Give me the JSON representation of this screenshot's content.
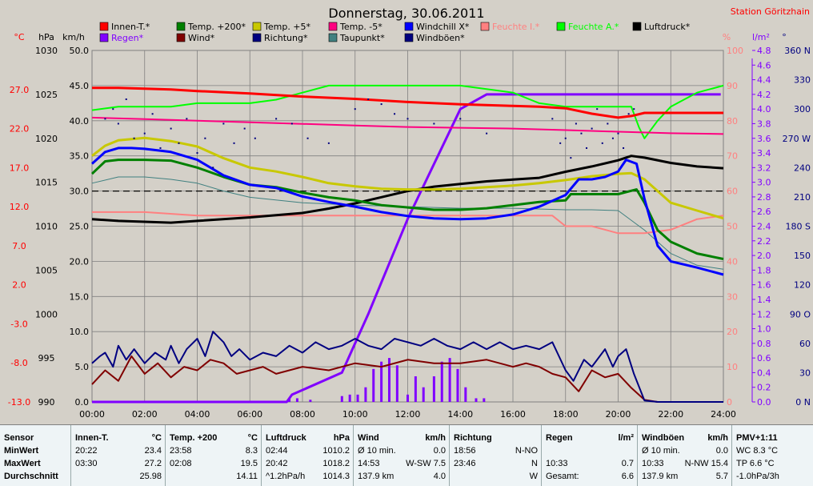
{
  "chart_data": {
    "type": "line",
    "title": "Donnerstag, 30.06.2011",
    "station": "Station Göritzhain",
    "x_range": [
      "00:00",
      "24:00"
    ],
    "x_ticks": [
      "00:00",
      "02:00",
      "04:00",
      "06:00",
      "08:00",
      "10:00",
      "12:00",
      "14:00",
      "16:00",
      "18:00",
      "20:00",
      "22:00",
      "24:00"
    ],
    "axes": {
      "celsius": {
        "unit": "°C",
        "range": [
          -13.0,
          32.0
        ],
        "ticks": [
          "27.0",
          "22.0",
          "17.0",
          "12.0",
          "7.0",
          "2.0",
          "-3.0",
          "-8.0",
          "-13.0"
        ]
      },
      "hpa": {
        "unit": "hPa",
        "range": [
          990,
          1030
        ],
        "ticks": [
          "1030",
          "1025",
          "1020",
          "1015",
          "1010",
          "1005",
          "1000",
          "995",
          "990"
        ]
      },
      "kmh": {
        "unit": "km/h",
        "range": [
          0.0,
          50.0
        ],
        "ticks": [
          "50.0",
          "45.0",
          "40.0",
          "35.0",
          "30.0",
          "25.0",
          "20.0",
          "15.0",
          "10.0",
          "5.0",
          "0.0"
        ]
      },
      "percent": {
        "unit": "%",
        "range": [
          0,
          100
        ],
        "ticks": [
          "100",
          "90",
          "80",
          "70",
          "60",
          "50",
          "40",
          "30",
          "20",
          "10",
          "0"
        ]
      },
      "rain": {
        "unit": "l/m²",
        "range": [
          0.0,
          4.8
        ],
        "ticks": [
          "4.8",
          "4.6",
          "4.4",
          "4.2",
          "4.0",
          "3.8",
          "3.6",
          "3.4",
          "3.2",
          "3.0",
          "2.8",
          "2.6",
          "2.4",
          "2.2",
          "2.0",
          "1.8",
          "1.6",
          "1.4",
          "1.2",
          "1.0",
          "0.8",
          "0.6",
          "0.4",
          "0.2",
          "0.0"
        ]
      },
      "direction": {
        "unit": "°",
        "range": [
          0,
          360
        ],
        "ticks": [
          "360 N",
          "330",
          "300",
          "270 W",
          "240",
          "210",
          "180 S",
          "150",
          "120",
          "90 O",
          "60",
          "30",
          "0 N"
        ]
      }
    },
    "legend": [
      {
        "name": "Innen-T.*",
        "color": "#ff0000"
      },
      {
        "name": "Temp. +200*",
        "color": "#008000"
      },
      {
        "name": "Temp. +5*",
        "color": "#c8c800"
      },
      {
        "name": "Temp. -5*",
        "color": "#ff0080"
      },
      {
        "name": "Windchill X*",
        "color": "#0000ff"
      },
      {
        "name": "Feuchte I.*",
        "color": "#ff8080"
      },
      {
        "name": "Feuchte A.*",
        "color": "#00ff00"
      },
      {
        "name": "Luftdruck*",
        "color": "#000000"
      },
      {
        "name": "Regen*",
        "color": "#8000ff"
      },
      {
        "name": "Wind*",
        "color": "#800000"
      },
      {
        "name": "Richtung*",
        "color": "#000080"
      },
      {
        "name": "Taupunkt*",
        "color": "#408080"
      },
      {
        "name": "Windböen*",
        "color": "#000080"
      }
    ],
    "series": [
      {
        "name": "Innen-T.*",
        "axis": "celsius",
        "color": "#ff0000",
        "width": 3,
        "x": [
          0,
          1,
          2,
          3,
          4,
          6,
          8,
          10,
          12,
          14,
          16,
          17,
          18,
          19,
          20,
          20.5,
          21,
          22,
          24
        ],
        "y": [
          27.2,
          27.2,
          27.1,
          27.0,
          26.8,
          26.5,
          26.1,
          25.8,
          25.4,
          25.1,
          24.9,
          24.8,
          24.6,
          23.9,
          23.4,
          23.6,
          24.0,
          24.0,
          24.0
        ]
      },
      {
        "name": "Temp. +200*",
        "axis": "celsius",
        "color": "#008000",
        "width": 3,
        "x": [
          0,
          0.5,
          1,
          2,
          3,
          4,
          5,
          6,
          7,
          8,
          9,
          10,
          11,
          12,
          13,
          14,
          15,
          16,
          17,
          18,
          18.2,
          19,
          20,
          20.7,
          21,
          21.5,
          22,
          23,
          24
        ],
        "y": [
          16.2,
          17.8,
          18.0,
          18.0,
          17.9,
          17.0,
          15.8,
          14.8,
          14.5,
          13.8,
          13.2,
          12.8,
          12.2,
          11.9,
          11.6,
          11.6,
          11.8,
          12.2,
          12.6,
          12.8,
          13.6,
          13.6,
          13.6,
          14.2,
          12.5,
          9.0,
          7.5,
          6.0,
          5.3
        ]
      },
      {
        "name": "Temp. +5*",
        "axis": "celsius",
        "color": "#c8c800",
        "width": 3,
        "x": [
          0,
          0.5,
          1,
          2,
          3,
          4,
          5,
          6,
          7,
          8,
          9,
          10,
          11,
          12,
          13,
          14,
          15,
          16,
          17,
          18,
          19,
          20,
          20.5,
          21,
          21.5,
          22,
          23,
          24
        ],
        "y": [
          18.5,
          19.8,
          20.5,
          20.8,
          20.4,
          19.7,
          18.2,
          17.0,
          16.5,
          15.8,
          15.0,
          14.6,
          14.3,
          14.2,
          14.2,
          14.3,
          14.5,
          14.7,
          15.0,
          15.4,
          15.9,
          16.2,
          16.3,
          15.5,
          14.0,
          12.5,
          11.5,
          10.5
        ]
      },
      {
        "name": "Temp. -5*",
        "axis": "celsius",
        "color": "#ff0080",
        "width": 2,
        "x": [
          0,
          2,
          4,
          6,
          8,
          10,
          12,
          14,
          16,
          18,
          20,
          22,
          24
        ],
        "y": [
          23.4,
          23.2,
          23.0,
          22.8,
          22.6,
          22.4,
          22.2,
          22.1,
          22.0,
          21.8,
          21.6,
          21.4,
          21.3
        ]
      },
      {
        "name": "Windchill X*",
        "axis": "celsius",
        "color": "#0000ff",
        "width": 3,
        "x": [
          0,
          0.5,
          1,
          1.5,
          2,
          3,
          4,
          5,
          6,
          7,
          8,
          9,
          10,
          11,
          12,
          13,
          14,
          15,
          16,
          17,
          18,
          18.5,
          19,
          19.5,
          20,
          20.3,
          20.7,
          21,
          21.5,
          22,
          23,
          24
        ],
        "y": [
          17.5,
          19.0,
          19.5,
          19.5,
          19.4,
          19.0,
          18.0,
          16.0,
          14.8,
          14.4,
          13.3,
          12.6,
          12.0,
          11.3,
          10.8,
          10.5,
          10.4,
          10.5,
          11.0,
          12.0,
          13.5,
          15.5,
          15.5,
          15.8,
          16.5,
          18.0,
          17.5,
          13.0,
          7.0,
          5.0,
          4.2,
          3.3
        ]
      },
      {
        "name": "Feuchte I.*",
        "axis": "percent",
        "color": "#ff8080",
        "width": 2,
        "x": [
          0,
          2,
          4,
          6,
          8,
          10,
          12,
          14,
          16,
          17.5,
          18,
          18.5,
          19,
          20,
          21,
          22,
          23,
          24
        ],
        "y": [
          54,
          54,
          53,
          53,
          53,
          53,
          53,
          53,
          53,
          53,
          50,
          50,
          50,
          48,
          48,
          49,
          52,
          53
        ]
      },
      {
        "name": "Feuchte A.*",
        "axis": "percent",
        "color": "#00ff00",
        "width": 2,
        "x": [
          0,
          1,
          2,
          3,
          4,
          5,
          6,
          7,
          8,
          9,
          10,
          11,
          12,
          14,
          16,
          17,
          18,
          19,
          20,
          20.5,
          20.8,
          21,
          21.5,
          22,
          23,
          24
        ],
        "y": [
          83,
          84,
          84,
          84,
          85,
          85,
          85,
          86,
          88,
          90,
          90,
          90,
          90,
          90,
          88,
          85,
          84,
          84,
          84,
          84,
          78,
          75,
          80,
          84,
          88,
          90
        ]
      },
      {
        "name": "Luftdruck*",
        "axis": "hpa",
        "color": "#000000",
        "width": 3,
        "x": [
          0,
          1,
          2,
          3,
          4,
          6,
          8,
          9,
          10,
          11,
          12,
          13,
          14,
          15,
          16,
          17,
          18,
          19,
          20,
          20.5,
          21,
          22,
          23,
          24
        ],
        "y": [
          1010.8,
          1010.6,
          1010.5,
          1010.4,
          1010.6,
          1011.0,
          1011.5,
          1012.0,
          1012.6,
          1013.3,
          1014.0,
          1014.5,
          1014.8,
          1015.1,
          1015.3,
          1015.5,
          1016.2,
          1016.8,
          1017.5,
          1018.0,
          1017.8,
          1017.2,
          1016.8,
          1016.6
        ]
      },
      {
        "name": "Taupunkt*",
        "axis": "celsius",
        "color": "#408080",
        "width": 1,
        "x": [
          0,
          1,
          2,
          3,
          4,
          5,
          6,
          8,
          10,
          12,
          14,
          16,
          18,
          19,
          20,
          21,
          22,
          23,
          24
        ],
        "y": [
          15.0,
          15.8,
          15.8,
          15.5,
          15.0,
          14.0,
          13.2,
          12.5,
          12.2,
          12.0,
          11.8,
          11.8,
          11.6,
          11.6,
          11.5,
          9.0,
          6.0,
          4.5,
          4.0
        ]
      },
      {
        "name": "Wind*",
        "axis": "kmh",
        "color": "#800000",
        "width": 2,
        "x": [
          0,
          0.5,
          1,
          1.5,
          2,
          2.5,
          3,
          3.5,
          4,
          4.5,
          5,
          5.5,
          6,
          6.5,
          7,
          8,
          9,
          10,
          11,
          12,
          13,
          14,
          15,
          16,
          16.5,
          17,
          17.5,
          18,
          18.5,
          19,
          19.5,
          20,
          20.5,
          21,
          21.5,
          22,
          23,
          24
        ],
        "y": [
          2.5,
          4.5,
          3.0,
          6.5,
          4.0,
          5.5,
          3.5,
          5.0,
          4.5,
          6.0,
          5.5,
          4.0,
          4.5,
          5.0,
          4.0,
          5.0,
          4.5,
          5.5,
          5.0,
          6.0,
          5.5,
          5.5,
          6.0,
          5.0,
          5.5,
          5.0,
          4.0,
          3.5,
          1.5,
          4.5,
          3.5,
          4.0,
          2.0,
          0.3,
          0.0,
          0.0,
          0.0,
          0.0
        ]
      },
      {
        "name": "Windböen*",
        "axis": "kmh",
        "color": "#000080",
        "width": 2,
        "x": [
          0,
          0.3,
          0.5,
          0.8,
          1,
          1.3,
          1.6,
          2,
          2.4,
          2.8,
          3,
          3.3,
          3.6,
          4,
          4.3,
          4.6,
          5,
          5.3,
          5.6,
          6,
          6.5,
          7,
          7.5,
          8,
          8.5,
          9,
          9.5,
          10,
          10.5,
          11,
          11.5,
          12,
          12.5,
          13,
          13.5,
          14,
          14.5,
          15,
          15.5,
          16,
          16.5,
          17,
          17.5,
          18,
          18.3,
          18.7,
          19,
          19.5,
          19.8,
          20,
          20.3,
          20.6,
          21,
          21.5,
          22,
          23,
          24
        ],
        "y": [
          5.5,
          6.5,
          7.0,
          5.0,
          8.0,
          6.0,
          7.5,
          5.5,
          7.0,
          6.0,
          8.0,
          5.5,
          7.5,
          9.0,
          6.5,
          10.0,
          8.5,
          6.5,
          7.5,
          6.0,
          7.0,
          6.5,
          8.0,
          7.0,
          8.5,
          7.5,
          8.0,
          9.0,
          8.0,
          7.5,
          9.0,
          8.5,
          8.0,
          9.0,
          8.0,
          7.5,
          8.5,
          7.5,
          8.5,
          7.5,
          8.0,
          7.5,
          8.5,
          4.5,
          3.0,
          6.0,
          5.0,
          7.5,
          5.0,
          6.5,
          7.5,
          4.0,
          0.2,
          0.0,
          0.0,
          0.0,
          0.0
        ]
      },
      {
        "name": "Richtung*",
        "axis": "direction",
        "color": "#000080",
        "type": "scatter",
        "x": [
          0.5,
          0.8,
          1.0,
          1.3,
          1.6,
          2.0,
          2.3,
          2.6,
          3.0,
          3.3,
          3.6,
          4.0,
          4.3,
          4.6,
          5.0,
          5.4,
          5.8,
          6.2,
          7.0,
          7.6,
          8.2,
          9.0,
          10.0,
          10.5,
          11.0,
          11.5,
          12.0,
          13.0,
          14.0,
          15.0,
          17.5,
          17.8,
          18.0,
          18.2,
          18.4,
          18.6,
          18.8,
          19.0,
          19.2,
          19.4,
          19.6,
          19.8,
          20.0,
          20.2,
          20.4,
          20.6
        ],
        "y": [
          290,
          300,
          285,
          310,
          270,
          275,
          295,
          260,
          280,
          265,
          290,
          255,
          270,
          240,
          285,
          265,
          280,
          270,
          290,
          285,
          270,
          265,
          300,
          310,
          305,
          295,
          290,
          285,
          290,
          275,
          290,
          265,
          270,
          250,
          285,
          275,
          260,
          280,
          300,
          265,
          285,
          270,
          275,
          260,
          295,
          300
        ]
      },
      {
        "name": "Regen*",
        "axis": "rain",
        "color": "#8000ff",
        "type": "bar",
        "x": [
          7.5,
          7.8,
          8.3,
          9.5,
          9.8,
          10.1,
          10.4,
          10.7,
          11.0,
          11.3,
          11.6,
          12.0,
          12.3,
          12.6,
          13.0,
          13.3,
          13.6,
          13.9,
          14.2,
          14.6,
          14.9
        ],
        "y": [
          0.05,
          0.05,
          0.03,
          0.08,
          0.1,
          0.1,
          0.2,
          0.45,
          0.55,
          0.6,
          0.5,
          0.1,
          0.35,
          0.2,
          0.35,
          0.55,
          0.6,
          0.45,
          0.2,
          0.05,
          0.05
        ]
      },
      {
        "name": "Regen* Summe",
        "axis": "rain",
        "color": "#8000ff",
        "width": 3,
        "x": [
          0,
          7.4,
          7.6,
          9.5,
          10.5,
          12,
          14,
          15,
          19,
          21,
          22,
          23.9
        ],
        "y": [
          0.0,
          0.0,
          0.1,
          0.4,
          1.2,
          2.5,
          4.0,
          4.2,
          4.2,
          4.2,
          4.2,
          4.2
        ]
      }
    ]
  },
  "stats": {
    "cols": [
      {
        "rows": [
          [
            "Sensor"
          ],
          [
            "MinWert"
          ],
          [
            "MaxWert"
          ],
          [
            "Durchschnitt"
          ]
        ]
      },
      {
        "rows": [
          [
            "Innen-T.",
            "°C"
          ],
          [
            "20:22",
            "23.4"
          ],
          [
            "03:30",
            "27.2"
          ],
          [
            "",
            "25.98"
          ]
        ]
      },
      {
        "rows": [
          [
            "Temp. +200",
            "°C"
          ],
          [
            "23:58",
            "8.3"
          ],
          [
            "02:08",
            "19.5"
          ],
          [
            "",
            "14.11"
          ]
        ]
      },
      {
        "rows": [
          [
            "Luftdruck",
            "hPa"
          ],
          [
            "02:44",
            "1010.2"
          ],
          [
            "20:42",
            "1018.2"
          ],
          [
            "^1.2hPa/h",
            "1014.3"
          ]
        ]
      },
      {
        "rows": [
          [
            "Wind",
            "km/h"
          ],
          [
            "Ø 10 min.",
            "0.0"
          ],
          [
            "14:53",
            "W-SW 7.5"
          ],
          [
            "137.9 km",
            "4.0"
          ]
        ]
      },
      {
        "rows": [
          [
            "Richtung"
          ],
          [
            "18:56",
            "N-NO"
          ],
          [
            "23:46",
            "N"
          ],
          [
            "",
            "W"
          ]
        ]
      },
      {
        "rows": [
          [
            "Regen",
            "l/m²"
          ],
          [
            "",
            ""
          ],
          [
            "10:33",
            "0.7"
          ],
          [
            "Gesamt:",
            "6.6"
          ]
        ]
      },
      {
        "rows": [
          [
            "Windböen",
            "km/h"
          ],
          [
            "Ø 10 min.",
            "0.0"
          ],
          [
            "10:33",
            "N-NW 15.4"
          ],
          [
            "137.9 km",
            "5.7"
          ]
        ]
      },
      {
        "rows": [
          [
            "PMV+1:11"
          ],
          [
            "WC 8.3 °C"
          ],
          [
            "TP 6.6 °C"
          ],
          [
            "-1.0hPa/3h"
          ]
        ]
      }
    ]
  }
}
